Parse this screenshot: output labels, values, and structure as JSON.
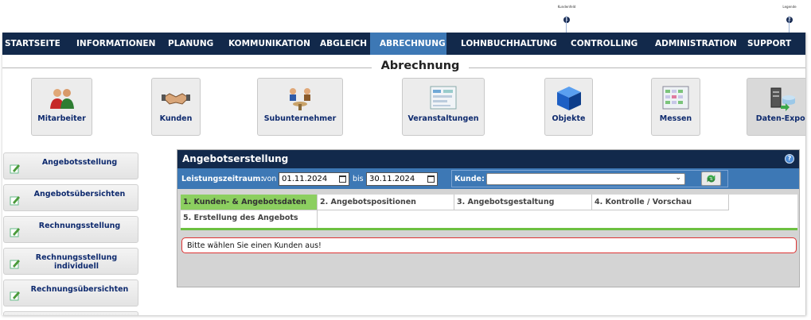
{
  "annotations": [
    {
      "label": "Kundenfeld",
      "number": "1"
    },
    {
      "label": "Legende",
      "number": "2"
    }
  ],
  "nav": {
    "items": [
      {
        "label": "STARTSEITE"
      },
      {
        "label": "INFORMATIONEN"
      },
      {
        "label": "PLANUNG"
      },
      {
        "label": "KOMMUNIKATION"
      },
      {
        "label": "ABGLEICH"
      },
      {
        "label": "ABRECHNUNG",
        "active": true
      },
      {
        "label": "LOHNBUCHHALTUNG"
      },
      {
        "label": "CONTROLLING"
      },
      {
        "label": "ADMINISTRATION"
      },
      {
        "label": "SUPPORT"
      }
    ]
  },
  "page_title": "Abrechnung",
  "modules": [
    {
      "label": "Mitarbeiter",
      "icon": "people-icon"
    },
    {
      "label": "Kunden",
      "icon": "handshake-icon"
    },
    {
      "label": "Subunternehmer",
      "icon": "meeting-icon"
    },
    {
      "label": "Veranstaltungen",
      "icon": "event-board-icon"
    },
    {
      "label": "Objekte",
      "icon": "cube-icon"
    },
    {
      "label": "Messen",
      "icon": "calendar-grid-icon"
    },
    {
      "label": "Daten-Expor",
      "icon": "data-export-icon"
    }
  ],
  "sidebar": {
    "items": [
      {
        "label": "Angebotsstellung"
      },
      {
        "label": "Angebotsübersichten"
      },
      {
        "label": "Rechnungsstellung"
      },
      {
        "label": "Rechnungsstellung individuell"
      },
      {
        "label": "Rechnungsübersichten"
      }
    ]
  },
  "panel": {
    "title": "Angebotserstellung",
    "filter": {
      "period_label": "Leistungszeitraum:",
      "from_label": "von",
      "from_value": "01.11.2024",
      "to_label": "bis",
      "to_value": "30.11.2024",
      "customer_label": "Kunde:",
      "customer_value": ""
    },
    "steps": [
      {
        "label": "1. Kunden- & Angebotsdaten",
        "active": true
      },
      {
        "label": "2. Angebotspositionen"
      },
      {
        "label": "3. Angebotsgestaltung"
      },
      {
        "label": "4. Kontrolle / Vorschau"
      },
      {
        "label": "5. Erstellung des Angebots"
      }
    ],
    "message": "Bitte wählen Sie einen Kunden aus!"
  },
  "colors": {
    "nav_bg": "#12294b",
    "nav_active": "#3d78b5",
    "step_active": "#8ccf60",
    "message_border": "#dd3333"
  }
}
